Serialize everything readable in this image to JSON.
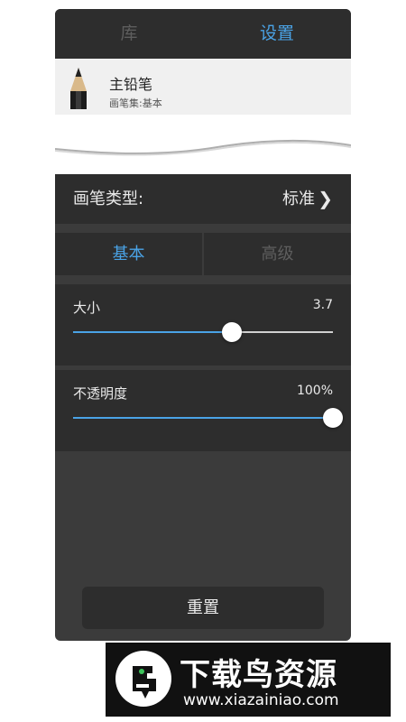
{
  "tabs": [
    {
      "label": "库",
      "active": false
    },
    {
      "label": "设置",
      "active": true
    }
  ],
  "brush": {
    "name": "主铅笔",
    "set": "画笔集:基本",
    "icon": "pencil-icon"
  },
  "brush_type": {
    "label": "画笔类型:",
    "value": "标准"
  },
  "segments": [
    {
      "label": "基本",
      "active": true
    },
    {
      "label": "高级",
      "active": false
    }
  ],
  "size": {
    "label": "大小",
    "value_text": "3.7",
    "fraction": 0.61
  },
  "opacity": {
    "label": "不透明度",
    "value_text": "100%",
    "fraction": 1.0
  },
  "reset_label": "重置",
  "watermark": {
    "title": "下载鸟资源",
    "url": "www.xiazainiao.com"
  },
  "colors": {
    "accent": "#4aa3e6",
    "panel": "#3b3b3b",
    "row": "#2d2d2d"
  }
}
